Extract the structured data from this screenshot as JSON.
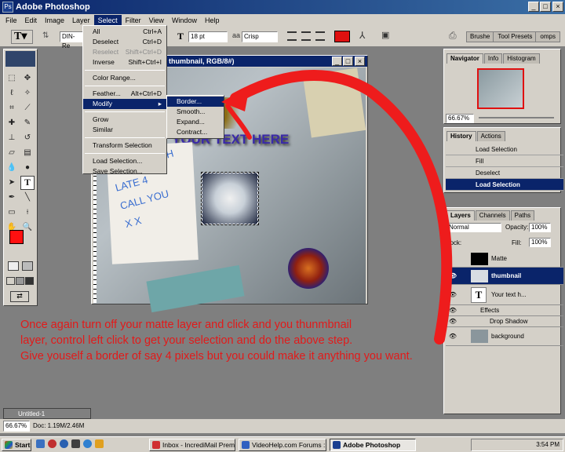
{
  "app": {
    "title": "Adobe Photoshop"
  },
  "menubar": [
    "File",
    "Edit",
    "Image",
    "Layer",
    "Select",
    "Filter",
    "View",
    "Window",
    "Help"
  ],
  "active_menu": "Select",
  "options_bar": {
    "font": "DIN-Re",
    "size": "18 pt",
    "antialias": "Crisp",
    "color": "#e01010",
    "tabs": [
      "Brushe",
      "Tool Presets",
      "omps"
    ]
  },
  "document": {
    "title_suffix": "thumbnail, RGB/8#)",
    "canvas_text": "YOUR TEXT HERE",
    "note_lines": [
      "GOTTA DASH",
      "LATE 4",
      "CALL YOU",
      "X X"
    ]
  },
  "select_menu": [
    {
      "label": "All",
      "shortcut": "Ctrl+A"
    },
    {
      "label": "Deselect",
      "shortcut": "Ctrl+D"
    },
    {
      "label": "Reselect",
      "shortcut": "Shift+Ctrl+D",
      "disabled": true
    },
    {
      "label": "Inverse",
      "shortcut": "Shift+Ctrl+I"
    },
    {
      "sep": true
    },
    {
      "label": "Color Range..."
    },
    {
      "sep": true
    },
    {
      "label": "Feather...",
      "shortcut": "Alt+Ctrl+D"
    },
    {
      "label": "Modify",
      "submenu": true,
      "highlight": true
    },
    {
      "sep": true
    },
    {
      "label": "Grow"
    },
    {
      "label": "Similar"
    },
    {
      "sep": true
    },
    {
      "label": "Transform Selection"
    },
    {
      "sep": true
    },
    {
      "label": "Load Selection..."
    },
    {
      "label": "Save Selection..."
    }
  ],
  "modify_submenu": [
    {
      "label": "Border...",
      "highlight": true
    },
    {
      "label": "Smooth..."
    },
    {
      "label": "Expand..."
    },
    {
      "label": "Contract..."
    }
  ],
  "navigator": {
    "tabs": [
      "Navigator",
      "Info",
      "Histogram"
    ],
    "zoom": "66.67%"
  },
  "history": {
    "tabs": [
      "History",
      "Actions"
    ],
    "items": [
      "Load Selection",
      "Fill",
      "Deselect",
      "Load Selection"
    ]
  },
  "layers": {
    "tabs": [
      "Layers",
      "Channels",
      "Paths"
    ],
    "blend": "Normal",
    "opacity_label": "Opacity:",
    "opacity": "100%",
    "lock_label": "Lock:",
    "fill_label": "Fill:",
    "fill": "100%",
    "items": [
      {
        "name": "Matte"
      },
      {
        "name": "thumbnail",
        "selected": true
      },
      {
        "name": "Your text h..."
      },
      {
        "name": "Effects",
        "sub": true
      },
      {
        "name": "Drop Shadow",
        "sub": true
      },
      {
        "name": "background"
      }
    ]
  },
  "annotation": "Once again turn off your matte layer and click and you thunmbnail\nlayer, control left click to get your selection and do the above step.\nGive youself a border of say 4 pixels but you could make it anything you want.",
  "minimized_window": "Untitled-1",
  "status": {
    "zoom": "66.67%",
    "doc": "Doc: 1.19M/2.46M"
  },
  "taskbar": {
    "start": "Start",
    "tasks": [
      "Inbox - IncrediMail Premium",
      "VideoHelp.com Forums :...",
      "Adobe Photoshop"
    ],
    "clock": "3:54 PM"
  }
}
